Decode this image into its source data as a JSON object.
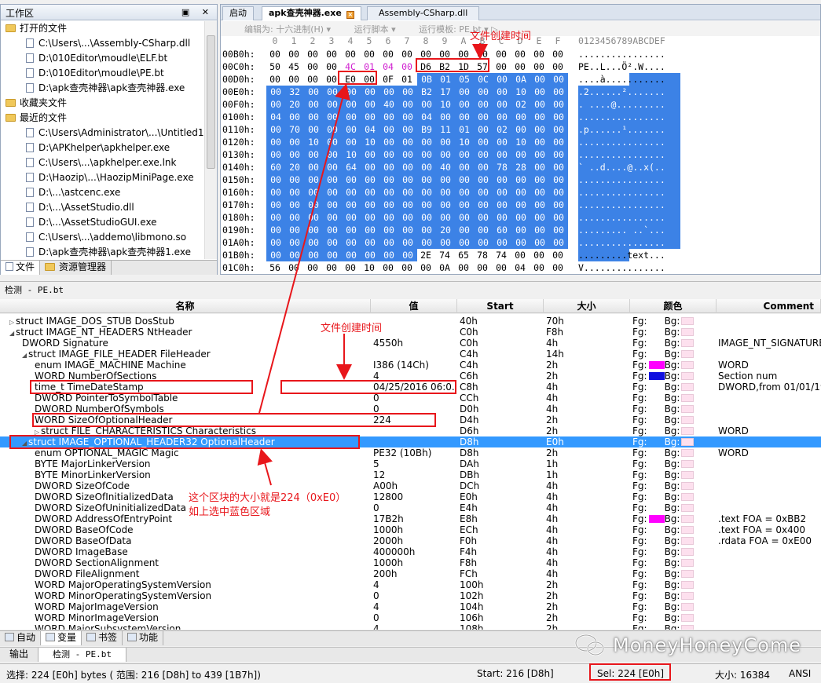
{
  "workspace": {
    "title": "工作区",
    "btns": "▣ ✕",
    "categories": [
      {
        "label": "打开的文件",
        "items": [
          "C:\\Users\\...\\Assembly-CSharp.dll",
          "D:\\010Editor\\moudle\\ELF.bt",
          "D:\\010Editor\\moudle\\PE.bt",
          "D:\\apk查壳神器\\apk查壳神器.exe"
        ]
      },
      {
        "label": "收藏夹文件",
        "items": []
      },
      {
        "label": "最近的文件",
        "items": [
          "C:\\Users\\Administrator\\...\\Untitled1",
          "D:\\APKhelper\\apkhelper.exe",
          "C:\\Users\\...\\apkhelper.exe.lnk",
          "D:\\Haozip\\...\\HaozipMiniPage.exe",
          "D:\\...\\astcenc.exe",
          "D:\\...\\AssetStudio.dll",
          "D:\\...\\AssetStudioGUI.exe",
          "C:\\Users\\...\\addemo\\libmono.so",
          "D:\\apk查壳神器\\apk查壳神器1.exe"
        ]
      }
    ],
    "tabs": [
      "文件",
      "资源管理器"
    ]
  },
  "hex": {
    "tabs": [
      "启动",
      "apk查壳神器.exe",
      "Assembly-CSharp.dll"
    ],
    "toolbar": [
      "编辑为: 十六进制(H) ▾",
      "运行脚本 ▾",
      "运行模板: PE.bt ▾  ▷"
    ],
    "col_header": [
      "0",
      "1",
      "2",
      "3",
      "4",
      "5",
      "6",
      "7",
      "8",
      "9",
      "A",
      "B",
      "C",
      "D",
      "E",
      "F"
    ],
    "ascii_header": "0123456789ABCDEF",
    "rows": [
      {
        "off": "00B0h:",
        "bytes": [
          "00",
          "00",
          "00",
          "00",
          "00",
          "00",
          "00",
          "00",
          "00",
          "00",
          "00",
          "00",
          "00",
          "00",
          "00",
          "00"
        ],
        "ascii": "................"
      },
      {
        "off": "00C0h:",
        "bytes": [
          "50",
          "45",
          "00",
          "00",
          "4C",
          "01",
          "04",
          "00",
          "D6",
          "B2",
          "1D",
          "57",
          "00",
          "00",
          "00",
          "00"
        ],
        "ascii": "PE..L...Ö².W...."
      },
      {
        "off": "00D0h:",
        "bytes": [
          "00",
          "00",
          "00",
          "00",
          "E0",
          "00",
          "0F",
          "01",
          "0B",
          "01",
          "05",
          "0C",
          "00",
          "0A",
          "00",
          "00"
        ],
        "ascii": "....à..........."
      },
      {
        "off": "00E0h:",
        "bytes": [
          "00",
          "32",
          "00",
          "00",
          "00",
          "00",
          "00",
          "00",
          "B2",
          "17",
          "00",
          "00",
          "00",
          "10",
          "00",
          "00"
        ],
        "ascii": ".2......²......."
      },
      {
        "off": "00F0h:",
        "bytes": [
          "00",
          "20",
          "00",
          "00",
          "00",
          "00",
          "40",
          "00",
          "00",
          "10",
          "00",
          "00",
          "00",
          "02",
          "00",
          "00"
        ],
        "ascii": ". ....@........."
      },
      {
        "off": "0100h:",
        "bytes": [
          "04",
          "00",
          "00",
          "00",
          "00",
          "00",
          "00",
          "00",
          "04",
          "00",
          "00",
          "00",
          "00",
          "00",
          "00",
          "00"
        ],
        "ascii": "................"
      },
      {
        "off": "0110h:",
        "bytes": [
          "00",
          "70",
          "00",
          "00",
          "00",
          "04",
          "00",
          "00",
          "B9",
          "11",
          "01",
          "00",
          "02",
          "00",
          "00",
          "00"
        ],
        "ascii": ".p......¹......."
      },
      {
        "off": "0120h:",
        "bytes": [
          "00",
          "00",
          "10",
          "00",
          "00",
          "10",
          "00",
          "00",
          "00",
          "00",
          "10",
          "00",
          "00",
          "10",
          "00",
          "00"
        ],
        "ascii": "................"
      },
      {
        "off": "0130h:",
        "bytes": [
          "00",
          "00",
          "00",
          "00",
          "10",
          "00",
          "00",
          "00",
          "00",
          "00",
          "00",
          "00",
          "00",
          "00",
          "00",
          "00"
        ],
        "ascii": "................"
      },
      {
        "off": "0140h:",
        "bytes": [
          "60",
          "20",
          "00",
          "00",
          "64",
          "00",
          "00",
          "00",
          "00",
          "40",
          "00",
          "00",
          "78",
          "28",
          "00",
          "00"
        ],
        "ascii": "` ..d....@..x(.."
      },
      {
        "off": "0150h:",
        "bytes": [
          "00",
          "00",
          "00",
          "00",
          "00",
          "00",
          "00",
          "00",
          "00",
          "00",
          "00",
          "00",
          "00",
          "00",
          "00",
          "00"
        ],
        "ascii": "................"
      },
      {
        "off": "0160h:",
        "bytes": [
          "00",
          "00",
          "00",
          "00",
          "00",
          "00",
          "00",
          "00",
          "00",
          "00",
          "00",
          "00",
          "00",
          "00",
          "00",
          "00"
        ],
        "ascii": "................"
      },
      {
        "off": "0170h:",
        "bytes": [
          "00",
          "00",
          "00",
          "00",
          "00",
          "00",
          "00",
          "00",
          "00",
          "00",
          "00",
          "00",
          "00",
          "00",
          "00",
          "00"
        ],
        "ascii": "................"
      },
      {
        "off": "0180h:",
        "bytes": [
          "00",
          "00",
          "00",
          "00",
          "00",
          "00",
          "00",
          "00",
          "00",
          "00",
          "00",
          "00",
          "00",
          "00",
          "00",
          "00"
        ],
        "ascii": "................"
      },
      {
        "off": "0190h:",
        "bytes": [
          "00",
          "00",
          "00",
          "00",
          "00",
          "00",
          "00",
          "00",
          "00",
          "20",
          "00",
          "00",
          "60",
          "00",
          "00",
          "00"
        ],
        "ascii": "......... ..`..."
      },
      {
        "off": "01A0h:",
        "bytes": [
          "00",
          "00",
          "00",
          "00",
          "00",
          "00",
          "00",
          "00",
          "00",
          "00",
          "00",
          "00",
          "00",
          "00",
          "00",
          "00"
        ],
        "ascii": "................"
      },
      {
        "off": "01B0h:",
        "bytes": [
          "00",
          "00",
          "00",
          "00",
          "00",
          "00",
          "00",
          "00",
          "2E",
          "74",
          "65",
          "78",
          "74",
          "00",
          "00",
          "00"
        ],
        "ascii": ".........text..."
      },
      {
        "off": "01C0h:",
        "bytes": [
          "56",
          "00",
          "00",
          "00",
          "00",
          "10",
          "00",
          "00",
          "00",
          "0A",
          "00",
          "00",
          "00",
          "04",
          "00",
          "00"
        ],
        "ascii": "V..............."
      }
    ]
  },
  "inspector": {
    "title": "检测 - PE.bt",
    "columns": [
      "名称",
      "值",
      "Start",
      "大小",
      "颜色",
      "Comment"
    ],
    "fg": "Fg:",
    "bg": "Bg:",
    "rows": [
      {
        "name": "struct IMAGE_DOS_STUB DosStub",
        "value": "",
        "start": "40h",
        "size": "70h",
        "comment": "",
        "tri": "▷",
        "fgcolor": ""
      },
      {
        "name": "struct IMAGE_NT_HEADERS NtHeader",
        "value": "",
        "start": "C0h",
        "size": "F8h",
        "comment": "",
        "tri": "◢",
        "fgcolor": ""
      },
      {
        "name": "DWORD Signature",
        "value": "4550h",
        "start": "C0h",
        "size": "4h",
        "comment": "IMAGE_NT_SIGNATURE",
        "tri": "",
        "fgcolor": ""
      },
      {
        "name": "struct IMAGE_FILE_HEADER FileHeader",
        "value": "",
        "start": "C4h",
        "size": "14h",
        "comment": "",
        "tri": "◢",
        "fgcolor": ""
      },
      {
        "name": "enum IMAGE_MACHINE Machine",
        "value": "I386 (14Ch)",
        "start": "C4h",
        "size": "2h",
        "comment": "WORD",
        "tri": "",
        "fgcolor": "#ff00ff"
      },
      {
        "name": "WORD NumberOfSections",
        "value": "4",
        "start": "C6h",
        "size": "2h",
        "comment": "Section num",
        "tri": "",
        "fgcolor": "#1010e0"
      },
      {
        "name": "time_t TimeDateStamp",
        "value": "04/25/2016 06:0...",
        "start": "C8h",
        "size": "4h",
        "comment": "DWORD,from 01/01/19",
        "tri": "",
        "fgcolor": ""
      },
      {
        "name": "DWORD PointerToSymbolTable",
        "value": "0",
        "start": "CCh",
        "size": "4h",
        "comment": "",
        "tri": "",
        "fgcolor": ""
      },
      {
        "name": "DWORD NumberOfSymbols",
        "value": "0",
        "start": "D0h",
        "size": "4h",
        "comment": "",
        "tri": "",
        "fgcolor": ""
      },
      {
        "name": "WORD SizeOfOptionalHeader",
        "value": "224",
        "start": "D4h",
        "size": "2h",
        "comment": "",
        "tri": "",
        "fgcolor": ""
      },
      {
        "name": "struct FILE_CHARACTERISTICS Characteristics",
        "value": "",
        "start": "D6h",
        "size": "2h",
        "comment": "WORD",
        "tri": "▷",
        "fgcolor": ""
      },
      {
        "name": "struct IMAGE_OPTIONAL_HEADER32 OptionalHeader",
        "value": "",
        "start": "D8h",
        "size": "E0h",
        "comment": "",
        "tri": "◢",
        "fgcolor": ""
      },
      {
        "name": "enum OPTIONAL_MAGIC Magic",
        "value": "PE32 (10Bh)",
        "start": "D8h",
        "size": "2h",
        "comment": "WORD",
        "tri": "",
        "fgcolor": ""
      },
      {
        "name": "BYTE MajorLinkerVersion",
        "value": "5",
        "start": "DAh",
        "size": "1h",
        "comment": "",
        "tri": "",
        "fgcolor": ""
      },
      {
        "name": "BYTE MinorLinkerVersion",
        "value": "12",
        "start": "DBh",
        "size": "1h",
        "comment": "",
        "tri": "",
        "fgcolor": ""
      },
      {
        "name": "DWORD SizeOfCode",
        "value": "A00h",
        "start": "DCh",
        "size": "4h",
        "comment": "",
        "tri": "",
        "fgcolor": ""
      },
      {
        "name": "DWORD SizeOfInitializedData",
        "value": "12800",
        "start": "E0h",
        "size": "4h",
        "comment": "",
        "tri": "",
        "fgcolor": ""
      },
      {
        "name": "DWORD SizeOfUninitializedData",
        "value": "0",
        "start": "E4h",
        "size": "4h",
        "comment": "",
        "tri": "",
        "fgcolor": ""
      },
      {
        "name": "DWORD AddressOfEntryPoint",
        "value": "17B2h",
        "start": "E8h",
        "size": "4h",
        "comment": ".text FOA = 0xBB2",
        "tri": "",
        "fgcolor": "#ff00ff"
      },
      {
        "name": "DWORD BaseOfCode",
        "value": "1000h",
        "start": "ECh",
        "size": "4h",
        "comment": ".text FOA = 0x400",
        "tri": "",
        "fgcolor": ""
      },
      {
        "name": "DWORD BaseOfData",
        "value": "2000h",
        "start": "F0h",
        "size": "4h",
        "comment": ".rdata FOA = 0xE00",
        "tri": "",
        "fgcolor": ""
      },
      {
        "name": "DWORD ImageBase",
        "value": "400000h",
        "start": "F4h",
        "size": "4h",
        "comment": "",
        "tri": "",
        "fgcolor": ""
      },
      {
        "name": "DWORD SectionAlignment",
        "value": "1000h",
        "start": "F8h",
        "size": "4h",
        "comment": "",
        "tri": "",
        "fgcolor": ""
      },
      {
        "name": "DWORD FileAlignment",
        "value": "200h",
        "start": "FCh",
        "size": "4h",
        "comment": "",
        "tri": "",
        "fgcolor": ""
      },
      {
        "name": "WORD MajorOperatingSystemVersion",
        "value": "4",
        "start": "100h",
        "size": "2h",
        "comment": "",
        "tri": "",
        "fgcolor": ""
      },
      {
        "name": "WORD MinorOperatingSystemVersion",
        "value": "0",
        "start": "102h",
        "size": "2h",
        "comment": "",
        "tri": "",
        "fgcolor": ""
      },
      {
        "name": "WORD MajorImageVersion",
        "value": "4",
        "start": "104h",
        "size": "2h",
        "comment": "",
        "tri": "",
        "fgcolor": ""
      },
      {
        "name": "WORD MinorImageVersion",
        "value": "0",
        "start": "106h",
        "size": "2h",
        "comment": "",
        "tri": "",
        "fgcolor": ""
      },
      {
        "name": "WORD MajorSubsystemVersion",
        "value": "4",
        "start": "108h",
        "size": "2h",
        "comment": "",
        "tri": "",
        "fgcolor": ""
      }
    ]
  },
  "bottom_tabs": [
    "自动",
    "变量",
    "书签",
    "功能"
  ],
  "bottom_tabs2": [
    "输出",
    "检测 - PE.bt"
  ],
  "status": {
    "selection": "选择: 224 [E0h] bytes ( 范围: 216 [D8h] to 439 [1B7h])",
    "start": "Start: 216 [D8h]",
    "sel": "Sel: 224 [E0h]",
    "size": "大小: 16384",
    "encoding": "ANSI"
  },
  "annotations": {
    "create_time_top": "文件创建时间",
    "create_time_mid": "文件创建时间",
    "block_note_1": "这个区块的大小就是224（0xE0）",
    "block_note_2": "如上选中蓝色区域"
  },
  "watermark": "MoneyHoneyCome",
  "colors": {
    "selection": "#3c82e6",
    "highlight_row": "#3399ff",
    "annotation": "#e8161b"
  }
}
